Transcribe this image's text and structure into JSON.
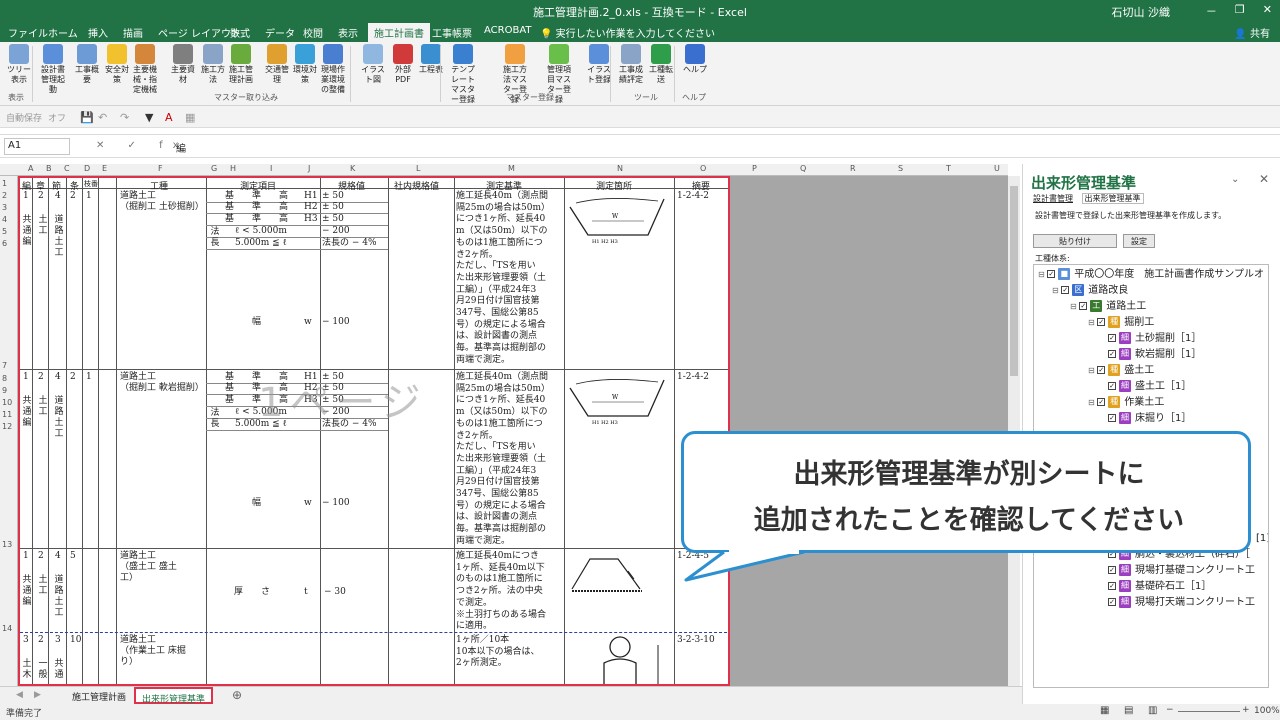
{
  "window": {
    "title": "施工管理計画.2_0.xls  -  互換モード  -  Excel",
    "user": "石切山 沙織",
    "minimize": "－",
    "restore": "❐",
    "close": "✕"
  },
  "tabs": [
    "ファイル",
    "ホーム",
    "挿入",
    "描画",
    "ページ レイアウト",
    "数式",
    "データ",
    "校閲",
    "表示",
    "施工計画書",
    "工事帳票",
    "ACROBAT"
  ],
  "active_tab": "施工計画書",
  "tell_me": "実行したい作業を入力してください",
  "share": "共有",
  "ribbon": {
    "buttons": [
      {
        "label": "ツリー表示",
        "color": "#7ba3d6"
      },
      {
        "label": "設計書管理起動",
        "color": "#5b8fd9"
      },
      {
        "label": "工事概要",
        "color": "#6c9bd6"
      },
      {
        "label": "安全対策",
        "color": "#f2c12e"
      },
      {
        "label": "主要機械・指定機械",
        "color": "#d4873a"
      },
      {
        "label": "主要資材",
        "color": "#7f7f7f"
      },
      {
        "label": "施工方法",
        "color": "#8aa4c8"
      },
      {
        "label": "施工管理計画",
        "color": "#6aab3e"
      },
      {
        "label": "交通管理",
        "color": "#e0a030"
      },
      {
        "label": "環境対策",
        "color": "#3aa0d8"
      },
      {
        "label": "現場作業環境の整備",
        "color": "#4a7ed0"
      },
      {
        "label": "イラスト図",
        "color": "#8fb7e0"
      },
      {
        "label": "外部PDF",
        "color": "#d03a3a"
      },
      {
        "label": "工程表",
        "color": "#3a8fd0"
      },
      {
        "label": "テンプレートマスター登録",
        "color": "#3a7fd0"
      },
      {
        "label": "施工方法マスター登録",
        "color": "#f0a040"
      },
      {
        "label": "管理項目マスター登録",
        "color": "#6abf4a"
      },
      {
        "label": "イラスト登録",
        "color": "#5b8fd9"
      },
      {
        "label": "工事成績評定",
        "color": "#8aa4c8"
      },
      {
        "label": "工種転送",
        "color": "#2e9e4a"
      },
      {
        "label": "ヘルプ",
        "color": "#3a6fd0"
      }
    ],
    "groups": [
      "表示",
      "マスター取り込み",
      "マスター登録",
      "ツール",
      "ヘルプ"
    ]
  },
  "qat": {
    "autosave": "自動保存",
    "autosave_state": "オフ"
  },
  "formula_bar": {
    "cell_ref": "A1",
    "fx": "✕ ✓ fx",
    "content": "編"
  },
  "columns": [
    "A",
    "B",
    "C",
    "D",
    "E",
    "F",
    "G",
    "H",
    "I",
    "J",
    "K",
    "L",
    "M",
    "N",
    "O",
    "P",
    "Q",
    "R",
    "S",
    "T",
    "U"
  ],
  "row_numbers": [
    "1",
    "2",
    "3",
    "4",
    "5",
    "6",
    "7",
    "8",
    "9",
    "10",
    "11",
    "12",
    "13",
    "14"
  ],
  "sheet": {
    "headers": [
      "編",
      "章",
      "節",
      "条",
      "枝番",
      "工種",
      "測定項目",
      "規格値",
      "社内規格値",
      "測定基準",
      "測定箇所",
      "摘要"
    ],
    "block1": {
      "nums": [
        "1",
        "2",
        "4",
        "2",
        "1"
      ],
      "hen": "共通編",
      "sho": "土工",
      "setsu": "道路土工",
      "kosyu": [
        "道路土工",
        "（掘削工 土砂掘削）"
      ],
      "items": [
        "基　　準　　高",
        "基　　準　　高",
        "基　　準　　高",
        "ℓ < 5.000m",
        "5.000m ≦ ℓ",
        "幅"
      ],
      "items_sym": [
        "H1",
        "H2",
        "H3",
        "",
        "",
        "w"
      ],
      "hou": "法長",
      "kikaku": [
        "± 50",
        "± 50",
        "± 50",
        "− 200",
        "法長の − 4%",
        "− 100"
      ],
      "kijun": [
        "施工延長40m（測点間",
        "隔25mの場合は50m）",
        "につき1ヶ所、延長40",
        "m（又は50m）以下の",
        "ものは1施工箇所につ",
        "き2ヶ所。",
        "ただし、「TSを用い",
        "た出来形管理要領（土",
        "工編）」（平成24年3",
        "月29日付け国官技第",
        "347号、国総公第85",
        "号）の規定による場合",
        "は、設計図書の測点",
        "毎。基準高は掘削部の",
        "両端で測定。"
      ],
      "tekiyo": "1-2-4-2"
    },
    "block2": {
      "nums": [
        "1",
        "2",
        "4",
        "2",
        "1"
      ],
      "hen": "共通編",
      "sho": "土工",
      "setsu": "道路土工",
      "kosyu": [
        "道路土工",
        "（掘削工 軟岩掘削）"
      ],
      "items": [
        "基　　準　　高",
        "基　　準　　高",
        "基　　準　　高",
        "ℓ < 5.000m",
        "5.000m ≦ ℓ",
        "幅"
      ],
      "items_sym": [
        "H1",
        "H2",
        "H3",
        "",
        "",
        "w"
      ],
      "hou": "法長",
      "kikaku": [
        "± 50",
        "± 50",
        "± 50",
        "− 200",
        "法長の − 4%",
        "− 100"
      ],
      "kijun": [
        "施工延長40m（測点間",
        "隔25mの場合は50m）",
        "につき1ヶ所、延長40",
        "m（又は50m）以下の",
        "ものは1施工箇所につ",
        "き2ヶ所。",
        "ただし、「TSを用い",
        "た出来形管理要領（土",
        "工編）」（平成24年3",
        "月29日付け国官技第",
        "347号、国総公第85",
        "号）の規定による場合",
        "は、設計図書の測点",
        "毎。基準高は掘削部の",
        "両端で測定。"
      ],
      "tekiyo": "1-2-4-2"
    },
    "block3": {
      "nums": [
        "1",
        "2",
        "4",
        "5",
        ""
      ],
      "hen": "共通編",
      "sho": "土工",
      "setsu": "道路土工",
      "kosyu": [
        "道路土工",
        "（盛土工 盛土",
        "工）"
      ],
      "item": "厚　　さ",
      "item_sym": "t",
      "kikaku": "− 30",
      "kijun": [
        "施工延長40mにつき",
        "1ヶ所、延長40m以下",
        "のものは1施工箇所に",
        "つき2ヶ所。法の中央",
        "で測定。",
        "※土羽打ちのある場合",
        "に適用。"
      ],
      "tekiyo": "1-2-4-5"
    },
    "block4": {
      "nums": [
        "3",
        "2",
        "3",
        "10",
        ""
      ],
      "hen": "土木",
      "sho": "一般",
      "setsu": "共通",
      "kosyu": [
        "道路土工",
        "（作業土工 床掘",
        "り）"
      ],
      "kijun": [
        "1ヶ所／10本",
        "10本以下の場合は、",
        "2ヶ所測定。"
      ],
      "tekiyo": "3-2-3-10"
    }
  },
  "watermark": "1ページ",
  "sheet_tabs": [
    "施工管理計画",
    "出来形管理基準"
  ],
  "active_sheet": "出来形管理基準",
  "status": {
    "ready": "準備完了",
    "zoom": "100%"
  },
  "pane": {
    "title": "出来形管理基準",
    "tabs": [
      "設計書管理",
      "出来形管理基準"
    ],
    "desc": "設計書管理で登録した出来形管理基準を作成します。",
    "paste_button": "貼り付け",
    "settings_button": "設定",
    "tree_label": "工種体系:",
    "tree": [
      {
        "badge": "",
        "color": "#5b8fd9",
        "text": "平成〇〇年度　施工計画書作成サンプルオ",
        "level": 0
      },
      {
        "badge": "区",
        "color": "#3a6fd0",
        "text": "道路改良",
        "level": 1
      },
      {
        "badge": "工",
        "color": "#3a7a30",
        "text": "道路土工",
        "level": 2
      },
      {
        "badge": "種",
        "color": "#e0a020",
        "text": "掘削工",
        "level": 3
      },
      {
        "badge": "細",
        "color": "#9b3fbf",
        "text": "土砂掘削［1］",
        "level": 4
      },
      {
        "badge": "細",
        "color": "#9b3fbf",
        "text": "軟岩掘削［1］",
        "level": 4
      },
      {
        "badge": "種",
        "color": "#e0a020",
        "text": "盛土工",
        "level": 3
      },
      {
        "badge": "細",
        "color": "#9b3fbf",
        "text": "盛土工［1］",
        "level": 4
      },
      {
        "badge": "種",
        "color": "#e0a020",
        "text": "作業土工",
        "level": 3
      },
      {
        "badge": "細",
        "color": "#9b3fbf",
        "text": "床掘り［1］",
        "level": 4
      },
      {
        "badge": "細",
        "color": "#9b3fbf",
        "text": "胴込・裏込材工（砕石）［",
        "level": 4
      },
      {
        "badge": "細",
        "color": "#9b3fbf",
        "text": "現場打基礎コンクリート工",
        "level": 4
      },
      {
        "badge": "細",
        "color": "#9b3fbf",
        "text": "基礎砕石工［1］",
        "level": 4
      },
      {
        "badge": "細",
        "color": "#9b3fbf",
        "text": "現場打天端コンクリート工",
        "level": 4
      }
    ],
    "tree_hidden_suffix": "[1]"
  },
  "callout": {
    "line1": "出来形管理基準が別シートに",
    "line2": "追加されたことを確認してください"
  }
}
